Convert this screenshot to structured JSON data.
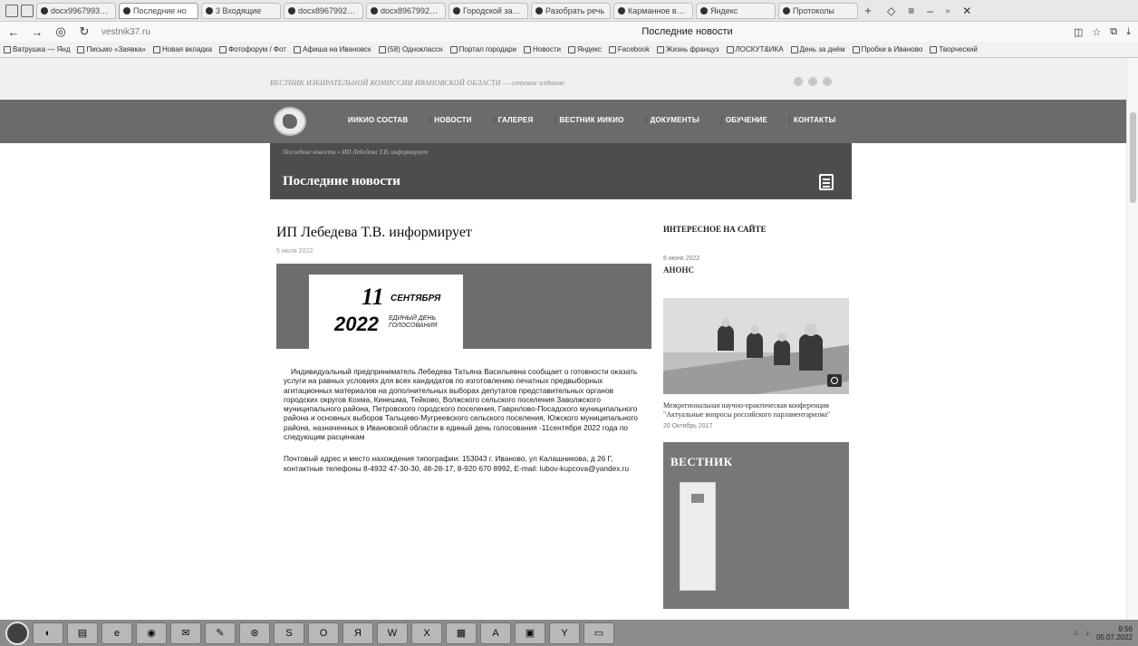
{
  "browser": {
    "tabs": [
      {
        "label": "docx9967993922"
      },
      {
        "label": "Последние но"
      },
      {
        "label": "3 Входящие"
      },
      {
        "label": "docx8967992202"
      },
      {
        "label": "docx8967992202"
      },
      {
        "label": "Городской запро"
      },
      {
        "label": "Разобрать речь"
      },
      {
        "label": "Карманное видео"
      },
      {
        "label": "Яндекс"
      },
      {
        "label": "Протоколы"
      }
    ],
    "new_tab": "+",
    "url": "vestnik37.ru",
    "window_title": "Последние новости",
    "bookmarks": [
      "Ватрушка — Янд",
      "Письмо «Заявка»",
      "Новая вкладка",
      "Фотофорум / Фот",
      "Афиша на Ивановск",
      "(58) Одноклассн",
      "Портал городари",
      "Новости",
      "Яндекс",
      "Facebook",
      "Жизнь француз",
      "ЛОСКУТ&ИКА",
      "День за днём",
      "Пробки в Иваново",
      "Творческий"
    ]
  },
  "site": {
    "top_tagline": "ВЕСТНИК ИЗБИРАТЕЛЬНОЙ КОМИССИИ ИВАНОВСКОЙ ОБЛАСТИ — сетевое издание",
    "nav": [
      "ИИКИО СОСТАВ",
      "НОВОСТИ",
      "ГАЛЕРЕЯ",
      "ВЕСТНИК ИИКИО",
      "ДОКУМЕНТЫ",
      "ОБУЧЕНИЕ",
      "КОНТАКТЫ"
    ],
    "breadcrumb": "Последние новости » ИП Лебедева Т.В. информирует",
    "page_title": "Последние новости"
  },
  "article": {
    "title": "ИП Лебедева Т.В. информирует",
    "date": "5 июля 2022",
    "banner": {
      "day": "11",
      "month": "СЕНТЯБРЯ",
      "year": "2022",
      "caption": "ЕДИНЫЙ ДЕНЬ ГОЛОСОВАНИЯ"
    },
    "body": "Индивидуальный предприниматель Лебедева Татьяна Васильевна сообщает о готовности оказать услуги на равных условиях для всех кандидатов по изготовлению печатных предвыборных агитационных материалов на дополнительных выборах депутатов представительных органов городских округов Кохма, Кинешма, Тейково, Волжского сельского поселения Заволжского муниципального района, Петровского городского поселения, Гаврилово-Посадского муниципального района и основных выборов Тальцево-Мугреевского сельского поселения, Южского муниципального района, назначенных в Ивановской области в единый день голосования -11сентября 2022 года по следующим расценкам",
    "address": "Почтовый адрес и место нахождения типографии: 153043 г. Иваново, ул Калашникова, д 26 Г, контактные телефоны 8-4932 47-30-30, 48-28-17, 8-920 670 8992, E-mail: lubov-kupcova@yandex.ru"
  },
  "sidebar": {
    "heading": "ИНТЕРЕСНОЕ НА САЙТЕ",
    "anons_date": "8 июня 2022",
    "anons_label": "АНОНС",
    "photo_caption": "Межрегиональная научно-практическая конференция \"Актуальные вопросы российского парламентаризма\"",
    "photo_date": "20 Октябрь 2017",
    "vestnik_title": "ВЕСТНИК"
  },
  "taskbar": {
    "clock_time": "9:56",
    "clock_date": "05.07.2022"
  }
}
